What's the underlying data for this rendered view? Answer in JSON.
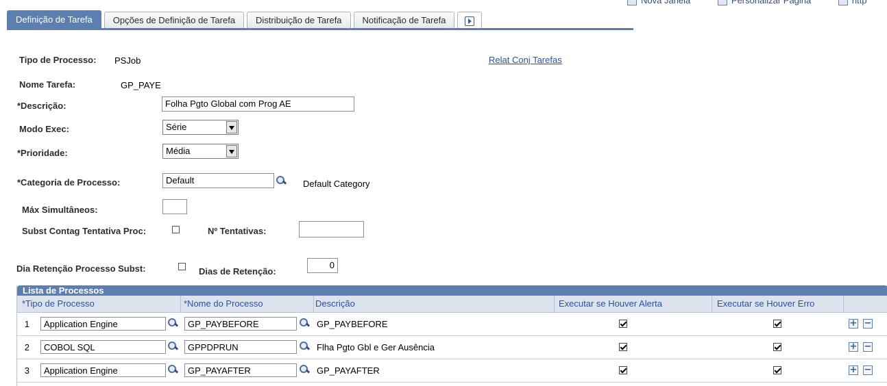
{
  "top_links": [
    "Nova Janela",
    "Personalizar Página",
    "http"
  ],
  "tabs": [
    {
      "label": "Definição de Tarefa",
      "active": true
    },
    {
      "label": "Opções de Definição de Tarefa",
      "active": false
    },
    {
      "label": "Distribuição de Tarefa",
      "active": false
    },
    {
      "label": "Notificação de Tarefa",
      "active": false
    }
  ],
  "form": {
    "tipo_processo_label": "Tipo de Processo:",
    "tipo_processo_value": "PSJob",
    "relat_link": "Relat Conj Tarefas",
    "nome_tarefa_label": "Nome Tarefa:",
    "nome_tarefa_value": "GP_PAYE",
    "descricao_label": "*Descrição:",
    "descricao_value": "Folha Pgto Global com Prog AE",
    "modo_exec_label": "Modo Exec:",
    "modo_exec_value": "Série",
    "prioridade_label": "*Prioridade:",
    "prioridade_value": "Média",
    "categoria_label": "*Categoria de Processo:",
    "categoria_value": "Default",
    "categoria_desc": "Default Category",
    "max_simult_label": "Máx Simultâneos:",
    "max_simult_value": "",
    "subst_contag_label": "Subst Contag Tentativa Proc:",
    "subst_contag_checked": false,
    "n_tentativas_label": "Nº Tentativas:",
    "n_tentativas_value": "",
    "dia_retencao_label": "Dia Retenção Processo Subst:",
    "dia_retencao_checked": false,
    "dias_retencao_label": "Dias de Retenção:",
    "dias_retencao_value": "0"
  },
  "grid": {
    "title": "Lista de Processos",
    "columns": [
      "*Tipo de Processo",
      "*Nome do Processo",
      "Descrição",
      "Executar se Houver Alerta",
      "Executar se Houver Erro"
    ],
    "rows": [
      {
        "num": "1",
        "tipo": "Application Engine",
        "nome": "GP_PAYBEFORE",
        "descricao": "GP_PAYBEFORE",
        "alerta": true,
        "erro": true
      },
      {
        "num": "2",
        "tipo": "COBOL SQL",
        "nome": "GPPDPRUN",
        "descricao": "Flha Pgto Gbl e Ger Ausência",
        "alerta": true,
        "erro": true
      },
      {
        "num": "3",
        "tipo": "Application Engine",
        "nome": "GP_PAYAFTER",
        "descricao": "GP_PAYAFTER",
        "alerta": true,
        "erro": true
      }
    ]
  }
}
